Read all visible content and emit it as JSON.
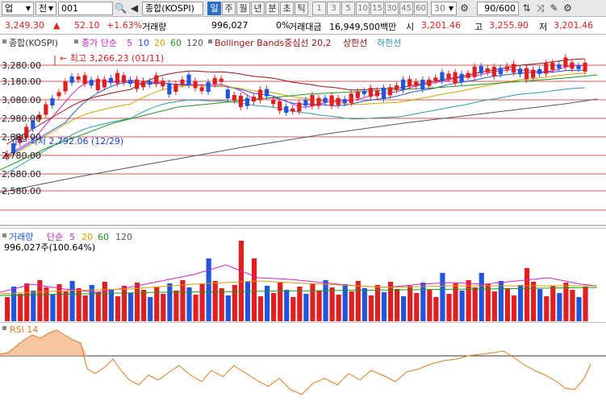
{
  "toolbar": {
    "type_select": "업",
    "period_select": "전",
    "code": "001",
    "name": "종합(KOSPI)",
    "periods": [
      "일",
      "주",
      "월",
      "년",
      "분",
      "초",
      "틱"
    ],
    "active_period": "일",
    "intervals": [
      "1",
      "3",
      "5",
      "10",
      "15",
      "30",
      "45",
      "60"
    ],
    "interval_input": "30",
    "count": "90/600"
  },
  "quote": {
    "price": "3,249.30",
    "arrow": "▲",
    "change": "52.10",
    "change_pct": "+1.63%",
    "volume_label": "거래량",
    "volume": "996,027",
    "volume_pct": "0%",
    "amount_label": "거래대금",
    "amount": "16,949,500백만",
    "open_label": "시",
    "open": "3,201.46",
    "high_label": "고",
    "high": "3,255.90",
    "low_label": "저",
    "low": "3,201.46"
  },
  "price_panel": {
    "series_name": "종합(KOSPI)",
    "ma_label": "종가 단순",
    "ma_periods": [
      "5",
      "10",
      "20",
      "60",
      "120"
    ],
    "bb_label": "Bollinger Bands중심선 20,2",
    "bb_upper": "상한선",
    "bb_lower": "하한선",
    "y_ticks": [
      "3,280.00",
      "3,180.00",
      "3,080.00",
      "2,980.00",
      "2,880.00",
      "2,780.00",
      "2,680.00",
      "2,580.00"
    ],
    "max_note": "최고 3,266.23 (01/11)",
    "min_note": "최저 2,792.06 (12/29)"
  },
  "volume_panel": {
    "label": "거래량",
    "ma_label": "단순",
    "ma_periods": [
      "5",
      "20",
      "60",
      "120"
    ],
    "value_text": "996,027주(100.64%)"
  },
  "rsi_panel": {
    "label": "RSI 14"
  },
  "colors": {
    "up": "#e02020",
    "down": "#2255dd",
    "ma5": "#cc22cc",
    "ma20": "#d4a000",
    "ma60": "#1a9a1a",
    "ma120": "#555555",
    "bb": "#9a1010",
    "bb_lower": "#2a9aaa",
    "rsi": "#e07a20"
  }
}
